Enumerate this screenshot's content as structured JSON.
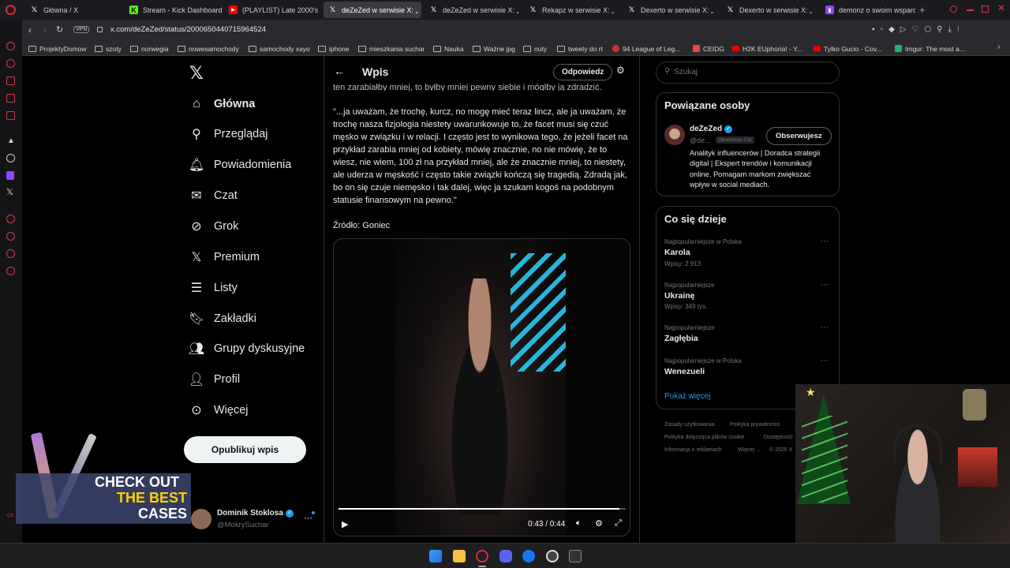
{
  "browser": {
    "tabs": [
      {
        "label": "Główna / X",
        "icon": "x-logo-icon"
      },
      {
        "label": "Stream - Kick Dashboard",
        "icon": "kick-icon"
      },
      {
        "label": "(PLAYLIST) Late 2000's",
        "icon": "youtube-icon"
      },
      {
        "label": "deZeZed w serwisie X: „",
        "icon": "x-logo-icon"
      },
      {
        "label": "deZeZed w serwisie X: „",
        "icon": "x-logo-icon"
      },
      {
        "label": "Rekapz w serwisie X: „",
        "icon": "x-logo-icon"
      },
      {
        "label": "Dexerto w serwisie X: „",
        "icon": "x-logo-icon"
      },
      {
        "label": "Dexerto w serwisie X: „",
        "icon": "x-logo-icon"
      },
      {
        "label": "demonz o swoim wsparc",
        "icon": "twitch-icon"
      }
    ],
    "new_tab": "+",
    "vpn": "VPN",
    "url": "x.com/deZeZed/status/2000650440715964524",
    "bookmarks": [
      "ProjektyDomow",
      "szoty",
      "norwegia",
      "nowesamochody",
      "samochody xayo",
      "iphone",
      "mieszkania suchar",
      "Nauka",
      "Ważne jpg",
      "nuty",
      "tweety do rt",
      "94 League of Leg...",
      "CEIDG",
      "H2K EUphoria! - Y...",
      "Tylko Gucio - Cov...",
      "Imgur: The most a..."
    ]
  },
  "nav": {
    "items": [
      {
        "label": "Główna",
        "icon": "home-icon"
      },
      {
        "label": "Przeglądaj",
        "icon": "search-icon"
      },
      {
        "label": "Powiadomienia",
        "icon": "bell-icon"
      },
      {
        "label": "Czat",
        "icon": "mail-icon"
      },
      {
        "label": "Grok",
        "icon": "grok-icon"
      },
      {
        "label": "Premium",
        "icon": "x-logo-icon"
      },
      {
        "label": "Listy",
        "icon": "list-icon"
      },
      {
        "label": "Zakładki",
        "icon": "bookmark-icon"
      },
      {
        "label": "Grupy dyskusyjne",
        "icon": "people-icon"
      },
      {
        "label": "Profil",
        "icon": "person-icon"
      },
      {
        "label": "Więcej",
        "icon": "more-icon"
      }
    ],
    "post_button": "Opublikuj wpis",
    "account": {
      "name": "Dominik Stoklosa",
      "handle": "@MokrySuchar"
    }
  },
  "promo": {
    "line1": "CHECK OUT",
    "line2": "THE BEST",
    "line3": "CASES"
  },
  "main": {
    "header_title": "Wpis",
    "reply_button": "Odpowiedz",
    "cut_line": "ten zarabiałby mniej, to byłby mniej pewny siebie i mógłby ją zdradzić.",
    "quote": "\"...ja uważam, że trochę, kurcz, no mogę mieć teraz lincz, ale ja uważam, że trochę nasza fizjologia niestety uwarunkowuje to, że facet musi się czuć męsko w związku i w relacji. I często jest to wynikowa tego, że jeżeli facet na przykład zarabia mniej od kobiety, mówię znacznie, no nie mówię, że to wiesz, nie wiem, 100 zł na przykład mniej, ale że znacznie mniej, to niestety, ale uderza w męskość i często takie związki kończą się tragedią. Zdradą jak, bo on się czuje niemęsko i tak dalej, więc ja szukam kogoś na podobnym statusie finansowym na pewno.\"",
    "source": "Źródło: Goniec",
    "video": {
      "time": "0:43 / 0:44",
      "progress": 0.977
    }
  },
  "sidebar": {
    "search_placeholder": "Szukaj",
    "related_title": "Powiązane osoby",
    "person": {
      "name": "deZeZed",
      "handle": "@de...",
      "follows_you": "Obserwuje Cię",
      "follow_button": "Obserwujesz",
      "bio": "Analityk influencerów | Doradca strategii digital | Ekspert trendów i komunikacji online. Pomagam markom zwiększać wpływ w social mediach."
    },
    "trends_title": "Co się dzieje",
    "trends": [
      {
        "meta": "Najpopularniejsze w Polska",
        "name": "Karola",
        "count": "Wpisy: 2 913"
      },
      {
        "meta": "Najpopularniejsze",
        "name": "Ukrainę",
        "count": "Wpisy: 349 tys."
      },
      {
        "meta": "Najpopularniejsze",
        "name": "Zagłębia",
        "count": ""
      },
      {
        "meta": "Najpopularniejsze w Polska",
        "name": "Wenezueli",
        "count": ""
      }
    ],
    "show_more": "Pokaż więcej",
    "footer": [
      "Zasady użytkowania",
      "Polityka prywatności",
      "Polityka dotycząca plików cookie",
      "Dostępność",
      "Informacja o reklamach",
      "Więcej ...",
      "© 2025 X"
    ]
  },
  "colors": {
    "accent": "#1d9bf0",
    "bg": "#000000",
    "border": "#2f3336",
    "muted": "#71767b"
  }
}
